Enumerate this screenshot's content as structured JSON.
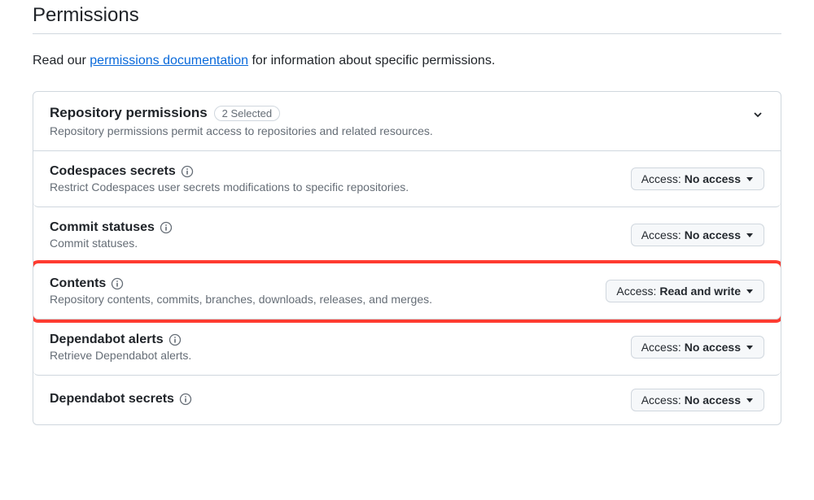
{
  "page": {
    "title": "Permissions",
    "intro_prefix": "Read our ",
    "intro_link": "permissions documentation",
    "intro_suffix": " for information about specific permissions."
  },
  "section": {
    "title": "Repository permissions",
    "badge": "2 Selected",
    "subtitle": "Repository permissions permit access to repositories and related resources."
  },
  "access_prefix": "Access: ",
  "rows": [
    {
      "title": "Codespaces secrets",
      "desc": "Restrict Codespaces user secrets modifications to specific repositories.",
      "access": "No access",
      "highlighted": false
    },
    {
      "title": "Commit statuses",
      "desc": "Commit statuses.",
      "access": "No access",
      "highlighted": false
    },
    {
      "title": "Contents",
      "desc": "Repository contents, commits, branches, downloads, releases, and merges.",
      "access": "Read and write",
      "highlighted": true
    },
    {
      "title": "Dependabot alerts",
      "desc": "Retrieve Dependabot alerts.",
      "access": "No access",
      "highlighted": false
    },
    {
      "title": "Dependabot secrets",
      "desc": "",
      "access": "No access",
      "highlighted": false
    }
  ]
}
